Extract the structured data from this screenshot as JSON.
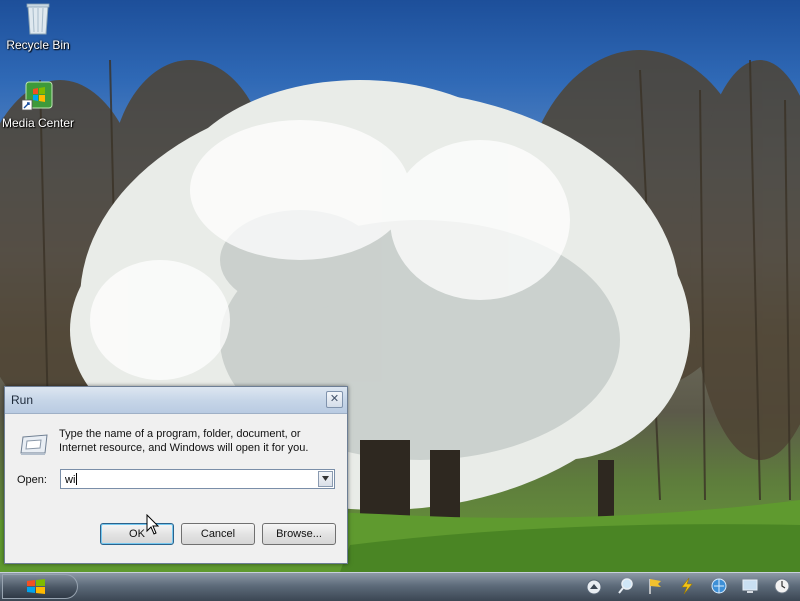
{
  "desktop": {
    "icons": [
      {
        "label": "Recycle Bin",
        "icon": "recycle-bin-icon"
      },
      {
        "label": "Media Center",
        "icon": "media-center-icon"
      }
    ]
  },
  "run_dialog": {
    "title": "Run",
    "close_symbol": "✕",
    "description": "Type the name of a program, folder, document, or Internet resource, and Windows will open it for you.",
    "open_label": "Open:",
    "input_value": "wi",
    "buttons": {
      "ok": "OK",
      "cancel": "Cancel",
      "browse": "Browse..."
    }
  },
  "taskbar": {
    "start_icon": "windows-logo-icon",
    "tray_icons": [
      "show-hidden-icons-icon",
      "search-icon",
      "flag-icon",
      "power-icon",
      "network-icon",
      "display-icon",
      "clock-icon"
    ]
  }
}
